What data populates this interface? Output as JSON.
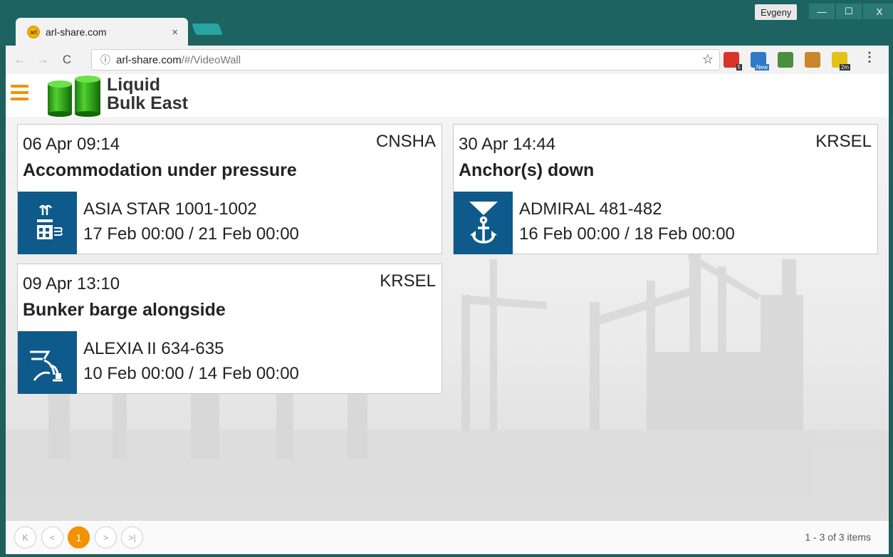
{
  "browser": {
    "tab_title": "arl-share.com",
    "tab_close": "×",
    "user": "Evgeny",
    "window_buttons": [
      "—",
      "☐",
      "X"
    ],
    "url_host": "arl-share.com",
    "url_path": "/#/VideoWall",
    "extensions": [
      {
        "name": "extension-1",
        "badge": "5",
        "color": "#d9332b"
      },
      {
        "name": "extension-2",
        "badge": "New",
        "color": "#2f79c8"
      },
      {
        "name": "extension-3",
        "badge": "",
        "color": "#4a8f3e"
      },
      {
        "name": "extension-4",
        "badge": "",
        "color": "#c9862a"
      },
      {
        "name": "extension-5",
        "badge": "2m",
        "color": "#e2c11a"
      }
    ]
  },
  "app": {
    "logo_line1": "Liquid",
    "logo_line2": "Bulk East"
  },
  "cards": [
    {
      "time": "06 Apr 09:14",
      "port": "CNSHA",
      "event": "Accommodation under pressure",
      "icon": "accommodation-icon",
      "vessel": "ASIA STAR 1001-1002",
      "dates": "17 Feb 00:00 / 21 Feb 00:00"
    },
    {
      "time": "30 Apr 14:44",
      "port": "KRSEL",
      "event": "Anchor(s) down",
      "icon": "anchor-icon",
      "vessel": "ADMIRAL 481-482",
      "dates": "16 Feb 00:00 / 18 Feb 00:00"
    },
    {
      "time": "09 Apr 13:10",
      "port": "KRSEL",
      "event": "Bunker barge alongside",
      "icon": "bunker-barge-icon",
      "vessel": "ALEXIA II 634-635",
      "dates": "10 Feb 00:00 / 14 Feb 00:00"
    }
  ],
  "pager": {
    "first": "K",
    "prev": "<",
    "current": "1",
    "next": ">",
    "last": ">|",
    "info": "1 - 3 of 3 items"
  },
  "colors": {
    "accent": "#f29200",
    "icon_bg": "#0e5a8a",
    "titlebar": "#1d6361"
  }
}
